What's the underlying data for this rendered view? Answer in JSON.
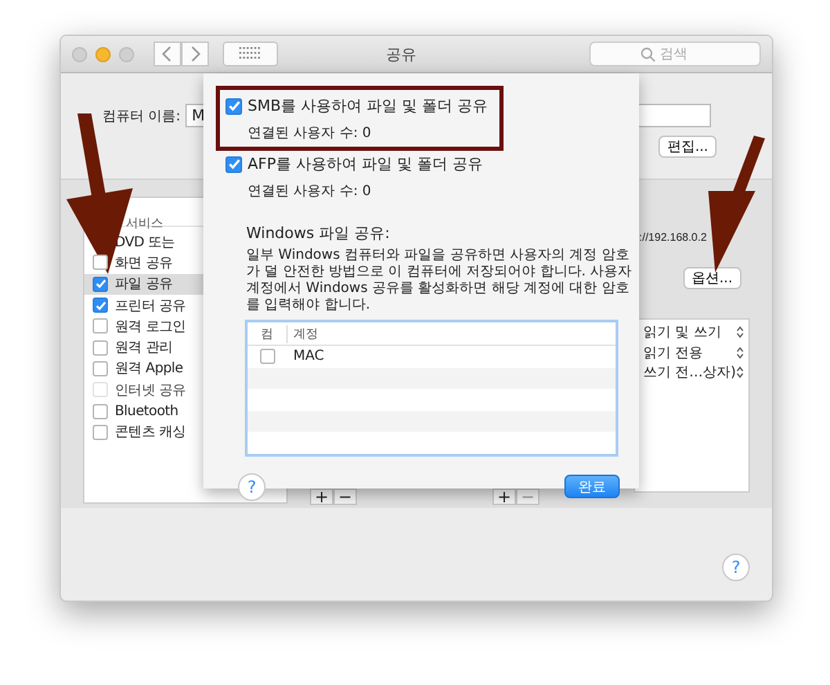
{
  "window": {
    "title": "공유",
    "search": {
      "placeholder": "검색"
    }
  },
  "computer_name": {
    "label": "컴퓨터 이름:",
    "value": "M",
    "edit_button": "편집..."
  },
  "services": {
    "header": "서비스",
    "items": [
      {
        "label": "DVD 또는",
        "selected": false
      },
      {
        "label": "화면 공유",
        "checked": false,
        "selected": false,
        "disabled": false
      },
      {
        "label": "파일 공유",
        "checked": true,
        "selected": true,
        "disabled": false
      },
      {
        "label": "프린터 공유",
        "checked": true,
        "selected": false,
        "disabled": false
      },
      {
        "label": "원격 로그인",
        "checked": false,
        "selected": false,
        "disabled": false
      },
      {
        "label": "원격 관리",
        "checked": false,
        "selected": false,
        "disabled": false
      },
      {
        "label": "원격 Apple",
        "checked": false,
        "selected": false,
        "disabled": false
      },
      {
        "label": "인터넷 공유",
        "checked": false,
        "selected": false,
        "disabled": true
      },
      {
        "label": "Bluetooth",
        "checked": false,
        "selected": false,
        "disabled": false
      },
      {
        "label": "콘텐츠 캐싱",
        "checked": false,
        "selected": false,
        "disabled": false
      }
    ]
  },
  "address": "://192.168.0.2",
  "options_button": "옵션...",
  "permissions": [
    "읽기 및 쓰기",
    "읽기 전용",
    "쓰기 전…상자)"
  ],
  "add_remove": [
    {
      "add": "+",
      "remove": "−",
      "remove_disabled": false
    },
    {
      "add": "+",
      "remove": "−",
      "remove_disabled": true
    }
  ],
  "help_button": "?",
  "sheet": {
    "options": [
      {
        "label": "SMB를 사용하여 파일 및 폴더 공유",
        "checked": true,
        "highlighted": true,
        "connected": "연결된 사용자 수: 0"
      },
      {
        "label": "AFP를 사용하여 파일 및 폴더 공유",
        "checked": true,
        "highlighted": false,
        "connected": "연결된 사용자 수: 0"
      }
    ],
    "windows_title": "Windows 파일 공유:",
    "windows_note": "일부 Windows 컴퓨터와 파일을 공유하면 사용자의 계정 암호가 덜 안전한 방법으로 이 컴퓨터에 저장되어야 합니다.  사용자 계정에서 Windows 공유를 활성화하면 해당 계정에 대한 암호를 입력해야 합니다.",
    "table": {
      "columns": [
        "컴",
        "계정"
      ],
      "rows": [
        {
          "account": "MAC",
          "checked": false
        }
      ]
    },
    "help_button": "?",
    "done_button": "완료"
  }
}
